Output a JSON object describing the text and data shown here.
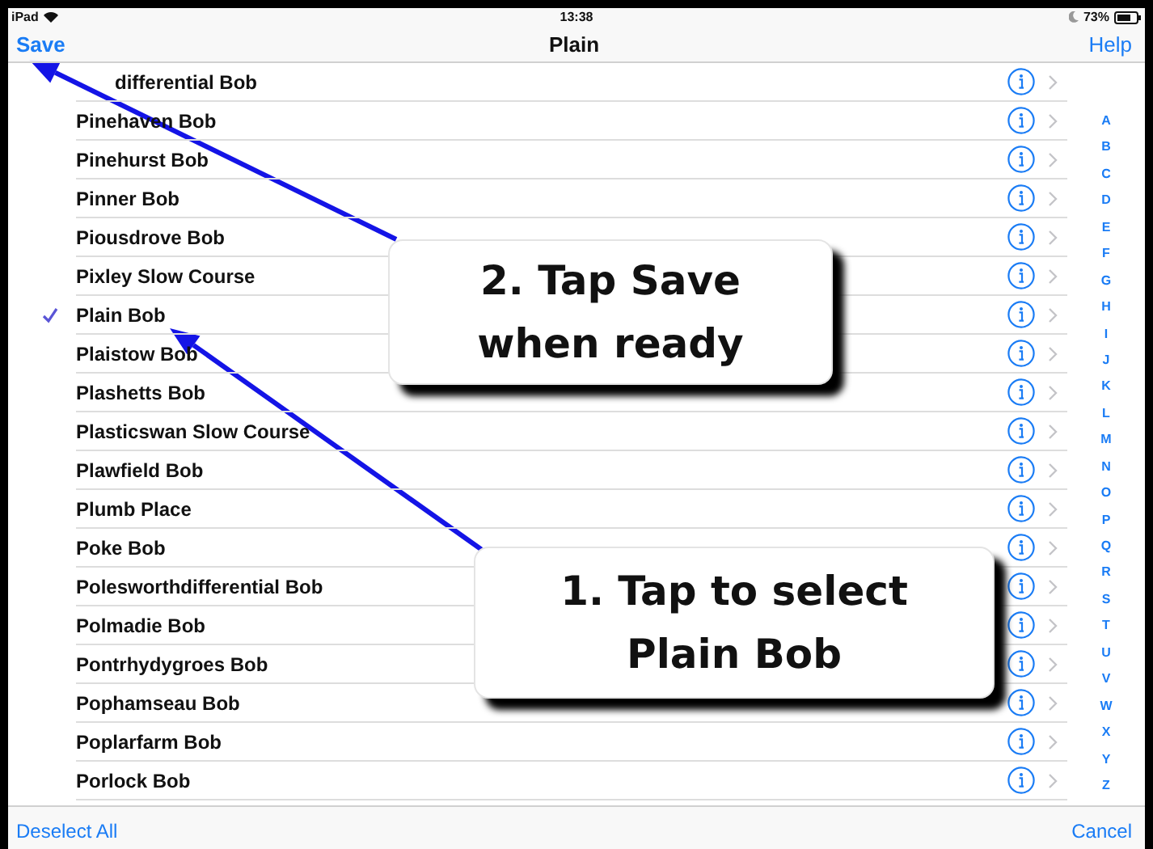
{
  "status_bar": {
    "device": "iPad",
    "time": "13:38",
    "battery": "73%"
  },
  "nav_bar": {
    "left": "Save",
    "title": "Plain",
    "right": "Help"
  },
  "rows": [
    {
      "name": "differential Bob",
      "selected": false
    },
    {
      "name": "Pinehaven Bob",
      "selected": false
    },
    {
      "name": "Pinehurst Bob",
      "selected": false
    },
    {
      "name": "Pinner Bob",
      "selected": false
    },
    {
      "name": "Piousdrove Bob",
      "selected": false
    },
    {
      "name": "Pixley Slow Course",
      "selected": false
    },
    {
      "name": "Plain Bob",
      "selected": true
    },
    {
      "name": "Plaistow Bob",
      "selected": false
    },
    {
      "name": "Plashetts Bob",
      "selected": false
    },
    {
      "name": "Plasticswan Slow Course",
      "selected": false
    },
    {
      "name": "Plawfield Bob",
      "selected": false
    },
    {
      "name": "Plumb Place",
      "selected": false
    },
    {
      "name": "Poke Bob",
      "selected": false
    },
    {
      "name": "Polesworthdifferential Bob",
      "selected": false
    },
    {
      "name": "Polmadie Bob",
      "selected": false
    },
    {
      "name": "Pontrhydygroes Bob",
      "selected": false
    },
    {
      "name": "Pophamseau Bob",
      "selected": false
    },
    {
      "name": "Poplarfarm Bob",
      "selected": false
    },
    {
      "name": "Porlock Bob",
      "selected": false
    }
  ],
  "index": [
    "A",
    "B",
    "C",
    "D",
    "E",
    "F",
    "G",
    "H",
    "I",
    "J",
    "K",
    "L",
    "M",
    "N",
    "O",
    "P",
    "Q",
    "R",
    "S",
    "T",
    "U",
    "V",
    "W",
    "X",
    "Y",
    "Z"
  ],
  "toolbar": {
    "left": "Deselect All",
    "right": "Cancel"
  },
  "callouts": [
    {
      "lines": [
        "2. Tap Save",
        "when ready"
      ]
    },
    {
      "lines": [
        "1. Tap to select",
        "Plain Bob"
      ]
    }
  ]
}
